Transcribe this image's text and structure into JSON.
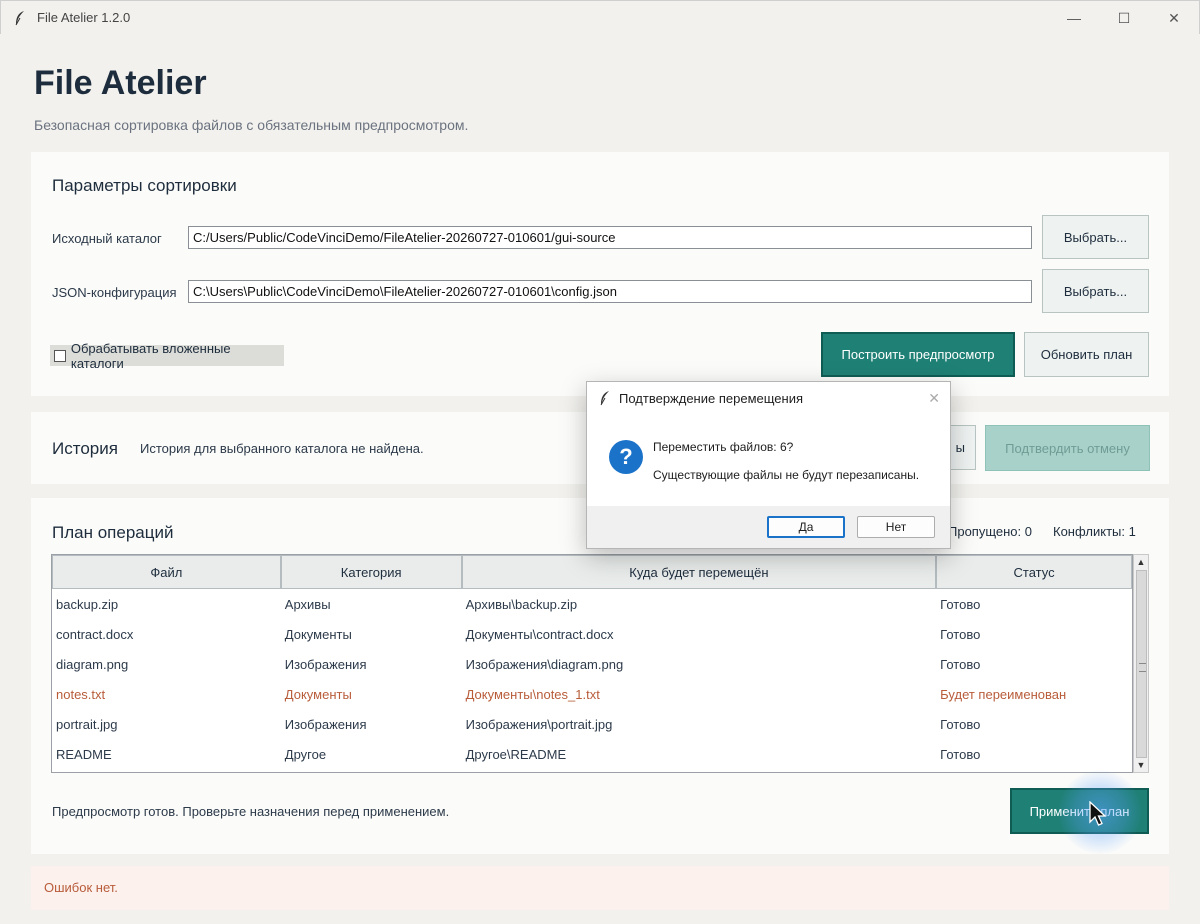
{
  "window": {
    "title": "File Atelier 1.2.0"
  },
  "header": {
    "title": "File Atelier",
    "subtitle": "Безопасная сортировка файлов с обязательным предпросмотром."
  },
  "params": {
    "title": "Параметры сортировки",
    "source_label": "Исходный каталог",
    "source_value": "C:/Users/Public/CodeVinciDemo/FileAtelier-20260727-010601/gui-source",
    "config_label": "JSON-конфигурация",
    "config_value": "C:\\Users\\Public\\CodeVinciDemo\\FileAtelier-20260727-010601\\config.json",
    "browse_label": "Выбрать...",
    "recursive_label": "Обрабатывать вложенные каталоги",
    "recursive_checked": false,
    "preview_button": "Построить предпросмотр",
    "refresh_button": "Обновить план"
  },
  "history": {
    "title": "История",
    "text": "История для выбранного каталога не найдена.",
    "hidden_button_fragment": "ы",
    "confirm_undo_button": "Подтвердить отмену"
  },
  "plan": {
    "title": "План операций",
    "skipped": "Пропущено: 0",
    "conflicts": "Конфликты: 1",
    "columns": [
      "Файл",
      "Категория",
      "Куда будет перемещён",
      "Статус"
    ],
    "rows": [
      {
        "file": "backup.zip",
        "category": "Архивы",
        "dest": "Архивы\\backup.zip",
        "status": "Готово",
        "warn": false
      },
      {
        "file": "contract.docx",
        "category": "Документы",
        "dest": "Документы\\contract.docx",
        "status": "Готово",
        "warn": false
      },
      {
        "file": "diagram.png",
        "category": "Изображения",
        "dest": "Изображения\\diagram.png",
        "status": "Готово",
        "warn": false
      },
      {
        "file": "notes.txt",
        "category": "Документы",
        "dest": "Документы\\notes_1.txt",
        "status": "Будет переименован",
        "warn": true
      },
      {
        "file": "portrait.jpg",
        "category": "Изображения",
        "dest": "Изображения\\portrait.jpg",
        "status": "Готово",
        "warn": false
      },
      {
        "file": "README",
        "category": "Другое",
        "dest": "Другое\\README",
        "status": "Готово",
        "warn": false
      }
    ],
    "status_text": "Предпросмотр готов. Проверьте назначения перед применением.",
    "apply_button": "Применить план"
  },
  "error_bar": {
    "text": "Ошибок нет."
  },
  "dialog": {
    "title": "Подтверждение перемещения",
    "message1": "Переместить файлов: 6?",
    "message2": "Существующие файлы не будут перезаписаны.",
    "yes": "Да",
    "no": "Нет",
    "icon": "question-icon"
  },
  "colors": {
    "accent": "#1f8075",
    "warning": "#b85c3a",
    "dialog_icon": "#1a73c9"
  }
}
